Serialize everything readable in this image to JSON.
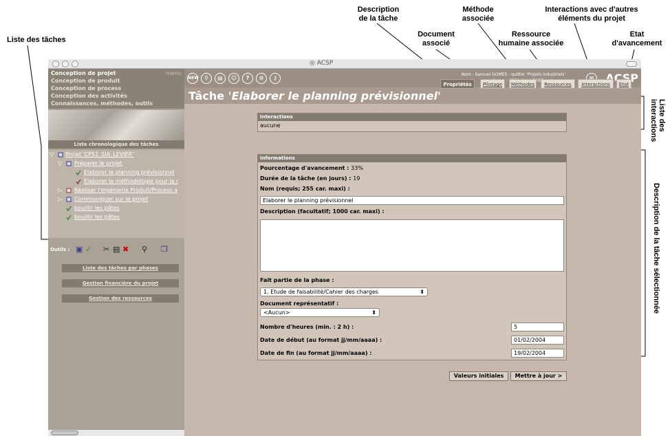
{
  "annotations": {
    "liste_taches": "Liste des tâches",
    "description_tache": [
      "Description",
      "de la tâche"
    ],
    "methode": [
      "Méthode",
      "associée"
    ],
    "interactions_autres": [
      "Interactions avec d'autres",
      "éléments du projet"
    ],
    "document": [
      "Document",
      "associé"
    ],
    "ressource": [
      "Ressource",
      "humaine associée"
    ],
    "etat": [
      "Etat",
      "d'avancement"
    ],
    "liste_interactions": [
      "Liste des",
      "interactions"
    ],
    "description_selection": "Description de la tâche sélectionnée"
  },
  "window": {
    "title": "ACSP"
  },
  "sidebar": {
    "menu_label": "menu",
    "menu_items": [
      "Conception de projet",
      "Conception de produit",
      "Conception de process",
      "Conception des activités",
      "Connaissances, méthodes, outils"
    ],
    "chrono_header": "Liste chronologique des tâches",
    "tree": [
      "Projet 'CPS1_SIA_LEVIER'",
      "Préparer le projet",
      "Elaborer le planning prévisionnel",
      "Elaborer la méthodologie pour la r",
      "Réaliser l'ingénierie Produit/Process a",
      "Communiquer sur le projet",
      "bouillir les pâtes",
      "bouillir les pâtes"
    ],
    "tools_label": "Outils :",
    "buttons": [
      "Liste des tâches par phases",
      "Gestion financière du projet",
      "Gestion des ressources"
    ]
  },
  "header": {
    "user_line": "Nom : Samuel GOMES - quitter 'Projets industriels'",
    "project_line": "Projet : CPS1_SIA_LEVIER - changer",
    "brand": "ACSP",
    "title_prefix": "Tâche '",
    "title_task": "Elaborer le planning prévisionnel",
    "title_suffix": "'"
  },
  "tabs": [
    "Propriétés",
    "Pilotage",
    "Méthodes",
    "Ressources",
    "Interactions",
    "Etat"
  ],
  "interactions": {
    "header": "Interactions",
    "value": "aucune"
  },
  "informations": {
    "header": "Informations",
    "pourcentage_label": "Pourcentage d'avancement :",
    "pourcentage_value": "33%",
    "duree_label": "Durée de la tâche (en jours) :",
    "duree_value": "19",
    "nom_label": "Nom (requis; 255 car. maxi) :",
    "nom_value": "Elaborer le planning prévisionnel",
    "description_label": "Description (facultatif; 1000 car. maxi) :",
    "phase_label": "Fait partie de la phase :",
    "phase_value": "1. Etude de faisabilité/Cahier des charges",
    "document_label": "Document représentatif :",
    "document_value": "<Aucun>",
    "heures_label": "Nombre d'heures (min. : 2 h) :",
    "heures_value": "5",
    "debut_label": "Date de début (au format jj/mm/aaaa) :",
    "debut_value": "01/02/2004",
    "fin_label": "Date de fin (au format jj/mm/aaaa) :",
    "fin_value": "19/02/2004"
  },
  "actions": {
    "reset": "Valeurs initiales",
    "update": "Mettre à jour >"
  }
}
